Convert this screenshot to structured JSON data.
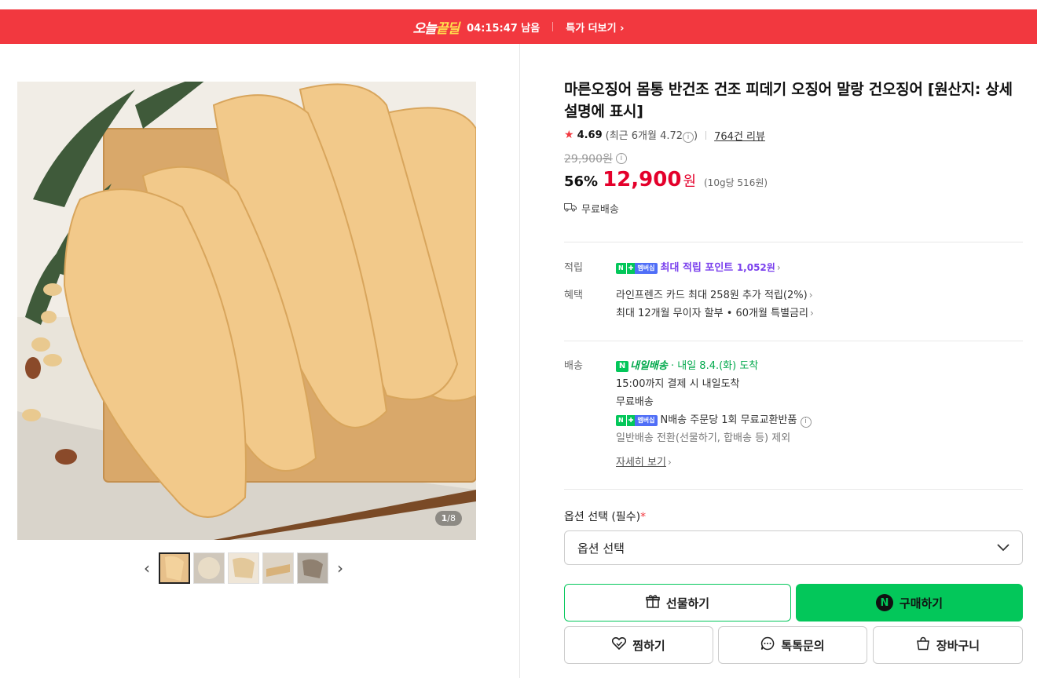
{
  "deal_bar": {
    "logo_part1": "오늘",
    "logo_part2": "끝딜",
    "timer": "04:15:47 남음",
    "more": "특가 더보기",
    "bg_color": "#f2383f"
  },
  "gallery": {
    "counter_current": "1",
    "counter_total": "/8",
    "thumbnail_count": 5,
    "prev_icon": "chevron-left-icon",
    "next_icon": "chevron-right-icon"
  },
  "product": {
    "title": "마른오징어 몸통 반건조 건조 피데기 오징어 말랑 건오징어 [원산지: 상세설명에 표시]",
    "rating": "4.69",
    "rating_recent": "(최근 6개월 4.72",
    "rating_recent_close": ")",
    "reviews": "764건 리뷰",
    "original_price": "29,900원",
    "discount": "56%",
    "price": "12,900",
    "price_unit": "원",
    "unit_price": "(10g당 516원)",
    "free_shipping": "무료배송"
  },
  "points": {
    "label": "적립",
    "badge_n": "N",
    "badge_plus": "✚",
    "badge_membership": "멤버십",
    "text": "최대 적립 포인트",
    "amount": "1,052원"
  },
  "benefits": {
    "label": "혜택",
    "line1": "라인프렌즈 카드 최대 258원 추가 적립(2%)",
    "line2": "최대 12개월 무이자 할부 • 60개월 특별금리"
  },
  "delivery": {
    "label": "배송",
    "badge": "내일배송",
    "badge_n": "N",
    "arrival": "· 내일 8.4.(화) 도착",
    "line1": "15:00까지 결제 시 내일도착",
    "line2": "무료배송",
    "line3": "N배송 주문당 1회 무료교환반품",
    "line4": "일반배송 전환(선물하기, 합배송 등) 제외",
    "more": "자세히 보기"
  },
  "option": {
    "label": "옵션 선택 (필수)",
    "required_mark": "*",
    "select_value": "옵션 선택"
  },
  "buttons": {
    "gift": "선물하기",
    "buy": "구매하기",
    "buy_logo": "N",
    "wish": "찜하기",
    "talk": "톡톡문의",
    "cart": "장바구니"
  },
  "colors": {
    "accent_red": "#e4002b",
    "naver_green": "#03c75a",
    "membership_purple": "#7a40ed"
  }
}
